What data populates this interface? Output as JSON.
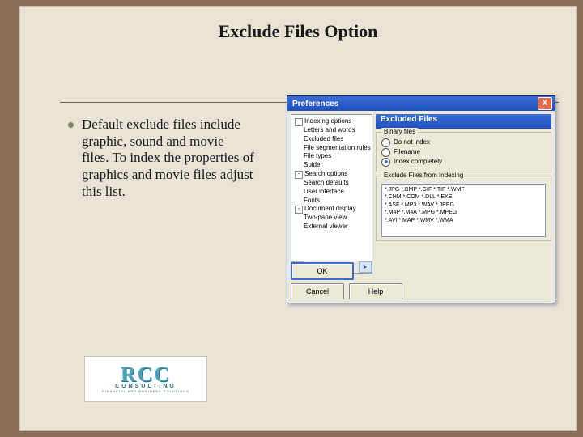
{
  "slide": {
    "title": "Exclude Files Option",
    "body": "Default exclude files include graphic, sound and movie files. To index the properties of graphics and movie files adjust this list."
  },
  "logo": {
    "main": "RCC",
    "sub": "CONSULTING",
    "tag": "FINANCIAL AND BUSINESS SOLUTIONS"
  },
  "dialog": {
    "title": "Preferences",
    "close": "X",
    "tree": {
      "items": [
        "Indexing options",
        "Letters and words",
        "Excluded files",
        "File segmentation rules",
        "File types",
        "Spider",
        "Search options",
        "Search defaults",
        "User interface",
        "Fonts",
        "Document display",
        "Two-pane view",
        "External viewer"
      ]
    },
    "scroll_left": "◄",
    "scroll_right": "►",
    "panel_header": "Excluded Files",
    "binary_group": {
      "title": "Binary files",
      "opt1": "Do not index",
      "opt2": "Filename",
      "opt3": "Index completely"
    },
    "exclude_group": {
      "title": "Exclude Files from Indexing",
      "lines": [
        "*.JPG *.BMP *.GIF *.TIF *.WMF",
        "*.CHM *.COM *.DLL *.EXE",
        "*.ASF *.MP3 *.WAV *.JPEG",
        "*.M4P *.M4A *.MPG *.MPEG",
        "*.AVI *.MAP *.WMV *.WMA"
      ]
    },
    "buttons": {
      "ok": "OK",
      "cancel": "Cancel",
      "help": "Help"
    }
  }
}
